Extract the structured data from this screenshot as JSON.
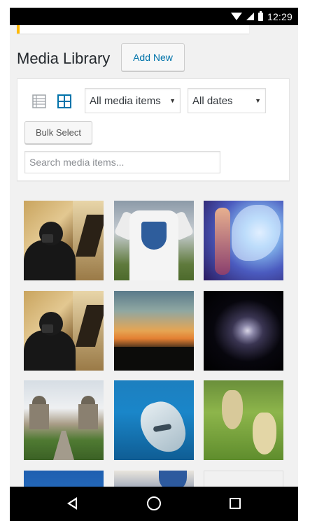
{
  "status_bar": {
    "time": "12:29"
  },
  "page": {
    "title": "Media Library",
    "add_new_label": "Add New"
  },
  "toolbar": {
    "media_filter": {
      "selected": "All media items"
    },
    "date_filter": {
      "selected": "All dates"
    },
    "bulk_select_label": "Bulk Select",
    "search_placeholder": "Search media items..."
  },
  "colors": {
    "accent": "#0073aa",
    "notice": "#ffb900",
    "active_icon": "#0073aa"
  },
  "media_items": [
    {
      "icon": "photo-thumbnail"
    },
    {
      "icon": "photo-thumbnail"
    },
    {
      "icon": "photo-thumbnail"
    },
    {
      "icon": "photo-thumbnail"
    },
    {
      "icon": "photo-thumbnail"
    },
    {
      "icon": "photo-thumbnail"
    },
    {
      "icon": "photo-thumbnail"
    },
    {
      "icon": "photo-thumbnail"
    },
    {
      "icon": "photo-thumbnail"
    },
    {
      "icon": "photo-thumbnail"
    },
    {
      "icon": "photo-thumbnail"
    },
    {
      "icon": "photo-thumbnail"
    }
  ]
}
